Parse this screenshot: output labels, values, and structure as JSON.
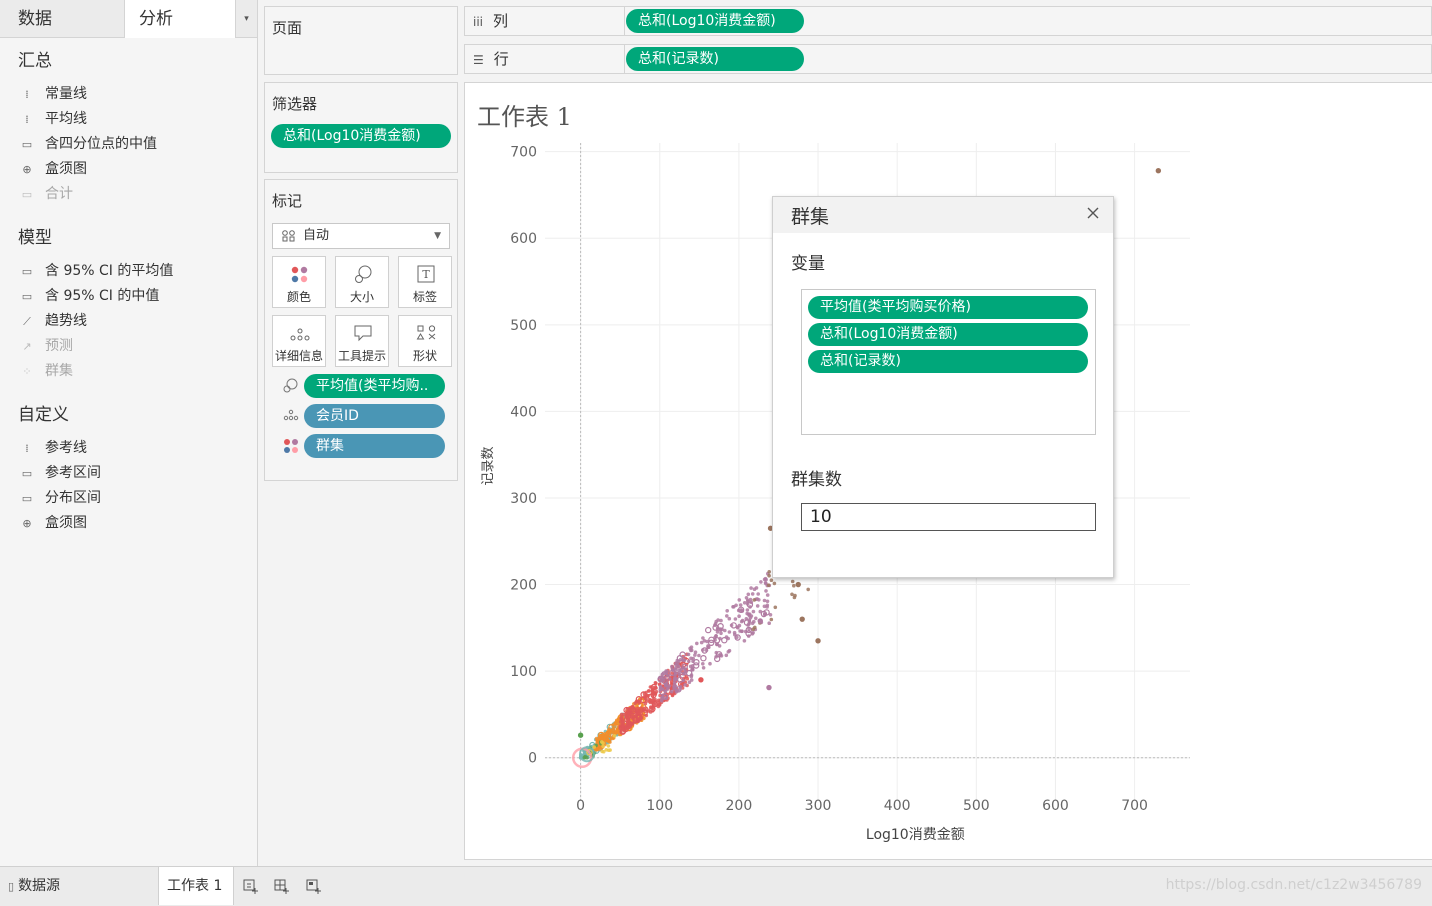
{
  "left_pane": {
    "tab_data": "数据",
    "tab_analysis": "分析",
    "tab_menu": "▾",
    "sections": [
      {
        "title": "汇总",
        "items": [
          {
            "label": "常量线",
            "icon": "constant-line-icon",
            "enabled": true
          },
          {
            "label": "平均线",
            "icon": "average-line-icon",
            "enabled": true
          },
          {
            "label": "含四分位点的中值",
            "icon": "median-quartiles-icon",
            "enabled": true
          },
          {
            "label": "盒须图",
            "icon": "box-plot-icon",
            "enabled": true
          },
          {
            "label": "合计",
            "icon": "totals-icon",
            "enabled": false
          }
        ]
      },
      {
        "title": "模型",
        "items": [
          {
            "label": "含 95% CI 的平均值",
            "icon": "average-ci-icon",
            "enabled": true
          },
          {
            "label": "含 95% CI 的中值",
            "icon": "median-ci-icon",
            "enabled": true
          },
          {
            "label": "趋势线",
            "icon": "trend-line-icon",
            "enabled": true
          },
          {
            "label": "预测",
            "icon": "forecast-icon",
            "enabled": false
          },
          {
            "label": "群集",
            "icon": "cluster-icon",
            "enabled": false
          }
        ]
      },
      {
        "title": "自定义",
        "items": [
          {
            "label": "参考线",
            "icon": "reference-line-icon",
            "enabled": true
          },
          {
            "label": "参考区间",
            "icon": "reference-band-icon",
            "enabled": true
          },
          {
            "label": "分布区间",
            "icon": "distribution-band-icon",
            "enabled": true
          },
          {
            "label": "盒须图",
            "icon": "box-plot-icon",
            "enabled": true
          }
        ]
      }
    ]
  },
  "pages_card": {
    "title": "页面"
  },
  "filters_card": {
    "title": "筛选器",
    "pill": "总和(Log10消费金额)"
  },
  "marks_card": {
    "title": "标记",
    "mark_type": "自动",
    "buttons": [
      "颜色",
      "大小",
      "标签",
      "详细信息",
      "工具提示",
      "形状"
    ],
    "fields": [
      {
        "label": "平均值(类平均购..",
        "color": "green",
        "icon": "size-icon"
      },
      {
        "label": "会员ID",
        "color": "blue",
        "icon": "detail-icon"
      },
      {
        "label": "群集",
        "color": "blue",
        "icon": "color-icon"
      }
    ]
  },
  "shelves": {
    "columns_label": "列",
    "columns_pill": "总和(Log10消费金额)",
    "rows_label": "行",
    "rows_pill": "总和(记录数)"
  },
  "sheet": {
    "title": "工作表 1"
  },
  "chart_data": {
    "type": "scatter",
    "xlabel": "Log10消费金额",
    "ylabel": "记录数",
    "xlim": [
      -45,
      770
    ],
    "ylim": [
      -50,
      710
    ],
    "x_ticks": [
      0,
      100,
      200,
      300,
      400,
      500,
      600,
      700
    ],
    "y_ticks": [
      0,
      100,
      200,
      300,
      400,
      500,
      600,
      700
    ],
    "grid": true,
    "colors": {
      "cluster_teal": "#76b7b2",
      "cluster_orange": "#f28e2b",
      "cluster_red": "#e15759",
      "cluster_purple": "#b07aa1",
      "cluster_brown": "#9c755f",
      "cluster_green": "#59a14f",
      "cluster_yellow": "#edc948",
      "cluster_blue": "#4e79a7",
      "cluster_pink": "#ff9da7"
    },
    "series": [
      {
        "color_key": "cluster_teal",
        "approx_points": 120,
        "x_range": [
          0,
          55
        ],
        "slope": 0.73
      },
      {
        "color_key": "cluster_orange",
        "approx_points": 180,
        "x_range": [
          20,
          80
        ],
        "slope": 0.74
      },
      {
        "color_key": "cluster_red",
        "approx_points": 260,
        "x_range": [
          50,
          135
        ],
        "slope": 0.76
      },
      {
        "color_key": "cluster_purple",
        "approx_points": 260,
        "x_range": [
          100,
          240
        ],
        "slope": 0.78
      },
      {
        "color_key": "cluster_brown",
        "approx_points": 20,
        "x_range": [
          215,
          290
        ],
        "slope": 0.78
      },
      {
        "color_key": "cluster_green",
        "approx_points": 12,
        "x_range": [
          0,
          30
        ],
        "slope": 0.5
      },
      {
        "color_key": "cluster_yellow",
        "approx_points": 12,
        "x_range": [
          10,
          50
        ],
        "slope": 0.4
      }
    ],
    "outliers": [
      {
        "x": 730,
        "y": 678,
        "color_key": "cluster_brown"
      },
      {
        "x": 300,
        "y": 135,
        "color_key": "cluster_brown"
      },
      {
        "x": 280,
        "y": 160,
        "color_key": "cluster_brown"
      },
      {
        "x": 275,
        "y": 200,
        "color_key": "cluster_brown"
      },
      {
        "x": 240,
        "y": 265,
        "color_key": "cluster_brown"
      },
      {
        "x": 238,
        "y": 81,
        "color_key": "cluster_purple"
      },
      {
        "x": 152,
        "y": 90,
        "color_key": "cluster_red"
      },
      {
        "x": 227,
        "y": 158,
        "color_key": "cluster_purple"
      },
      {
        "x": 0,
        "y": 26,
        "color_key": "cluster_green"
      }
    ]
  },
  "cluster_dialog": {
    "title": "群集",
    "variables_label": "变量",
    "variables": [
      "平均值(类平均购买价格)",
      "总和(Log10消费金额)",
      "总和(记录数)"
    ],
    "count_label": "群集数",
    "count_value": "10"
  },
  "bottom_bar": {
    "datasource_tab": "数据源",
    "sheet_tab": "工作表 1",
    "watermark": "https://blog.csdn.net/c1z2w3456789"
  }
}
